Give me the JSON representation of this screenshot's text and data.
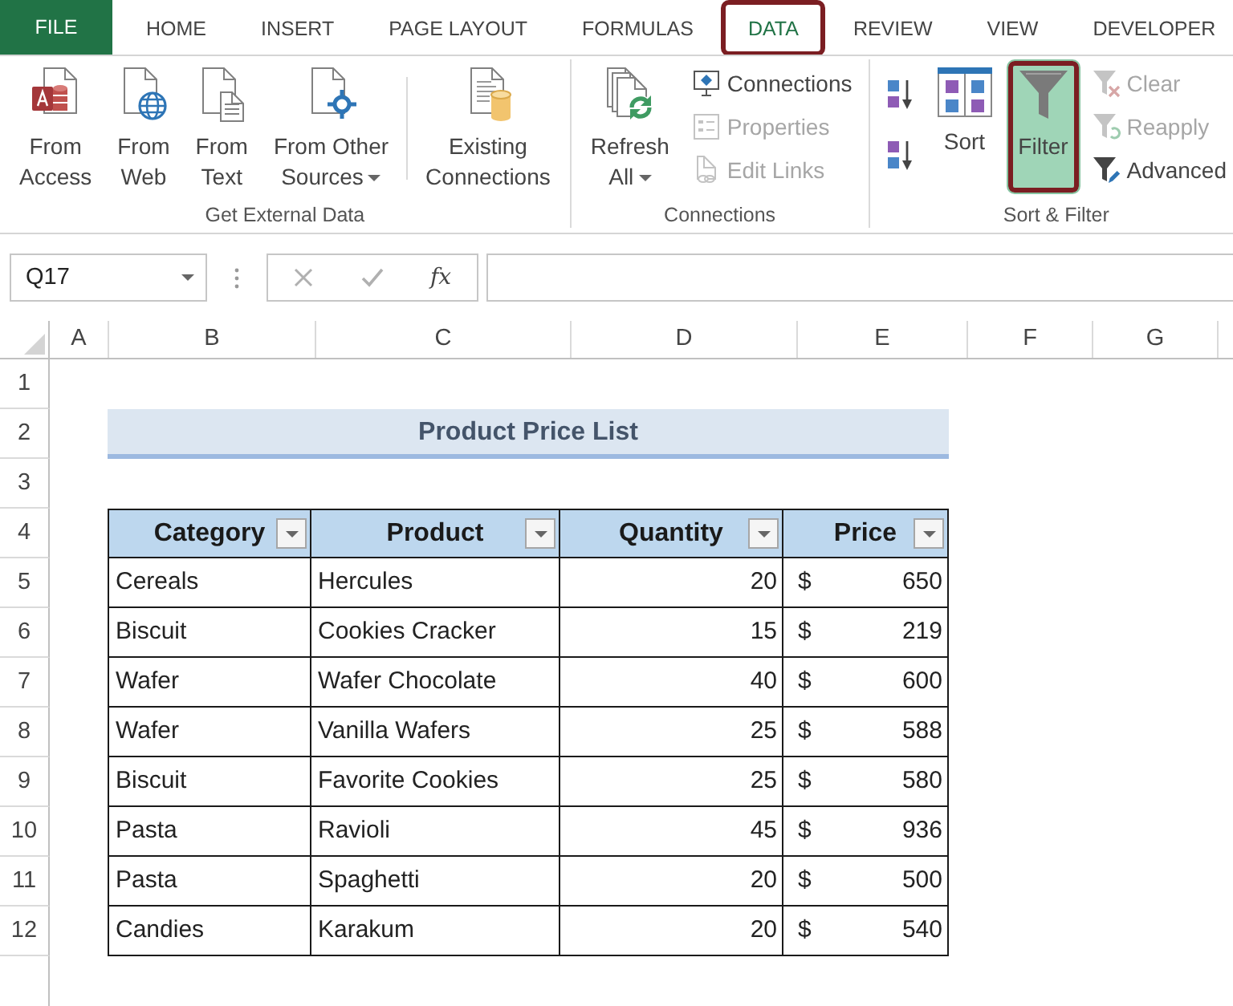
{
  "tabs": [
    {
      "label": "FILE",
      "kind": "file",
      "selected": false,
      "highlighted": false
    },
    {
      "label": "HOME",
      "kind": "tab",
      "selected": false,
      "highlighted": false
    },
    {
      "label": "INSERT",
      "kind": "tab",
      "selected": false,
      "highlighted": false
    },
    {
      "label": "PAGE LAYOUT",
      "kind": "tab",
      "selected": false,
      "highlighted": false
    },
    {
      "label": "FORMULAS",
      "kind": "tab",
      "selected": false,
      "highlighted": false
    },
    {
      "label": "DATA",
      "kind": "tab",
      "selected": true,
      "highlighted": true
    },
    {
      "label": "REVIEW",
      "kind": "tab",
      "selected": false,
      "highlighted": false
    },
    {
      "label": "VIEW",
      "kind": "tab",
      "selected": false,
      "highlighted": false
    },
    {
      "label": "DEVELOPER",
      "kind": "tab",
      "selected": false,
      "highlighted": false
    }
  ],
  "ribbon": {
    "groups": [
      {
        "label": "Get External Data",
        "sections": [
          {
            "buttons": [
              {
                "kind": "access",
                "label": [
                  "From",
                  "Access"
                ],
                "dropdown": false,
                "disabled": false,
                "pressed": false,
                "highlighted": false
              },
              {
                "kind": "web",
                "label": [
                  "From",
                  "Web"
                ],
                "dropdown": false,
                "disabled": false,
                "pressed": false,
                "highlighted": false
              },
              {
                "kind": "text-file",
                "label": [
                  "From",
                  "Text"
                ],
                "dropdown": false,
                "disabled": false,
                "pressed": false,
                "highlighted": false
              },
              {
                "kind": "other-sources",
                "label": [
                  "From Other",
                  "Sources"
                ],
                "dropdown": true,
                "disabled": false,
                "pressed": false,
                "highlighted": false
              }
            ]
          },
          {
            "buttons": [
              {
                "kind": "existing-connections",
                "label": [
                  "Existing",
                  "Connections"
                ],
                "dropdown": false,
                "disabled": false,
                "pressed": false,
                "highlighted": false
              }
            ]
          }
        ]
      },
      {
        "label": "Connections",
        "sections": [
          {
            "buttons": [
              {
                "kind": "refresh",
                "label": [
                  "Refresh",
                  "All"
                ],
                "dropdown": true,
                "disabled": false,
                "pressed": false,
                "highlighted": false
              },
              {
                "kind": "connections",
                "label": "Connections",
                "dropdown": false,
                "disabled": false,
                "pressed": false,
                "highlighted": false
              },
              {
                "kind": "properties",
                "label": "Properties",
                "dropdown": false,
                "disabled": true,
                "pressed": false,
                "highlighted": false
              },
              {
                "kind": "edit-links",
                "label": "Edit Links",
                "dropdown": false,
                "disabled": true,
                "pressed": false,
                "highlighted": false
              }
            ]
          }
        ]
      },
      {
        "label": "Sort & Filter",
        "sections": [
          {
            "buttons": [
              {
                "kind": "sort-ascending",
                "dropdown": false,
                "disabled": false,
                "pressed": false,
                "highlighted": false
              },
              {
                "kind": "sort-descending",
                "dropdown": false,
                "disabled": false,
                "pressed": false,
                "highlighted": false
              },
              {
                "kind": "sort",
                "label": [
                  "Sort"
                ],
                "dropdown": false,
                "disabled": false,
                "pressed": false,
                "highlighted": false
              },
              {
                "kind": "filter",
                "label": [
                  "Filter"
                ],
                "dropdown": false,
                "disabled": false,
                "pressed": true,
                "highlighted": true
              },
              {
                "kind": "clear",
                "label": "Clear",
                "dropdown": false,
                "disabled": true,
                "pressed": false,
                "highlighted": false
              },
              {
                "kind": "reapply",
                "label": "Reapply",
                "dropdown": false,
                "disabled": true,
                "pressed": false,
                "highlighted": false
              },
              {
                "kind": "advanced",
                "label": "Advanced",
                "dropdown": false,
                "disabled": false,
                "pressed": false,
                "highlighted": false
              }
            ]
          }
        ]
      }
    ]
  },
  "formula_bar": {
    "name_box": "Q17",
    "buttons": [
      {
        "kind": "cancel",
        "disabled": true
      },
      {
        "kind": "enter",
        "disabled": true
      },
      {
        "kind": "insert-function",
        "label": "fx",
        "disabled": false
      }
    ]
  },
  "sheet": {
    "columns": [
      "A",
      "B",
      "C",
      "D",
      "E",
      "F",
      "G"
    ],
    "rows": [
      "1",
      "2",
      "3",
      "4",
      "5",
      "6",
      "7",
      "8",
      "9",
      "10",
      "11",
      "12"
    ],
    "title": "Product Price List",
    "table": {
      "columns": [
        {
          "label": "Category",
          "filter": true
        },
        {
          "label": "Product",
          "filter": true
        },
        {
          "label": "Quantity",
          "filter": true
        },
        {
          "label": "Price",
          "filter": true
        }
      ],
      "rows": [
        {
          "category": "Cereals",
          "product": "Hercules",
          "quantity": "20",
          "currency": "$",
          "price": "650"
        },
        {
          "category": "Biscuit",
          "product": "Cookies Cracker",
          "quantity": "15",
          "currency": "$",
          "price": "219"
        },
        {
          "category": "Wafer",
          "product": "Wafer Chocolate",
          "quantity": "40",
          "currency": "$",
          "price": "600"
        },
        {
          "category": "Wafer",
          "product": "Vanilla Wafers",
          "quantity": "25",
          "currency": "$",
          "price": "588"
        },
        {
          "category": "Biscuit",
          "product": "Favorite Cookies",
          "quantity": "25",
          "currency": "$",
          "price": "580"
        },
        {
          "category": "Pasta",
          "product": "Ravioli",
          "quantity": "45",
          "currency": "$",
          "price": "936"
        },
        {
          "category": "Pasta",
          "product": "Spaghetti",
          "quantity": "20",
          "currency": "$",
          "price": "500"
        },
        {
          "category": "Candies",
          "product": "Karakum",
          "quantity": "20",
          "currency": "$",
          "price": "540"
        }
      ]
    }
  }
}
